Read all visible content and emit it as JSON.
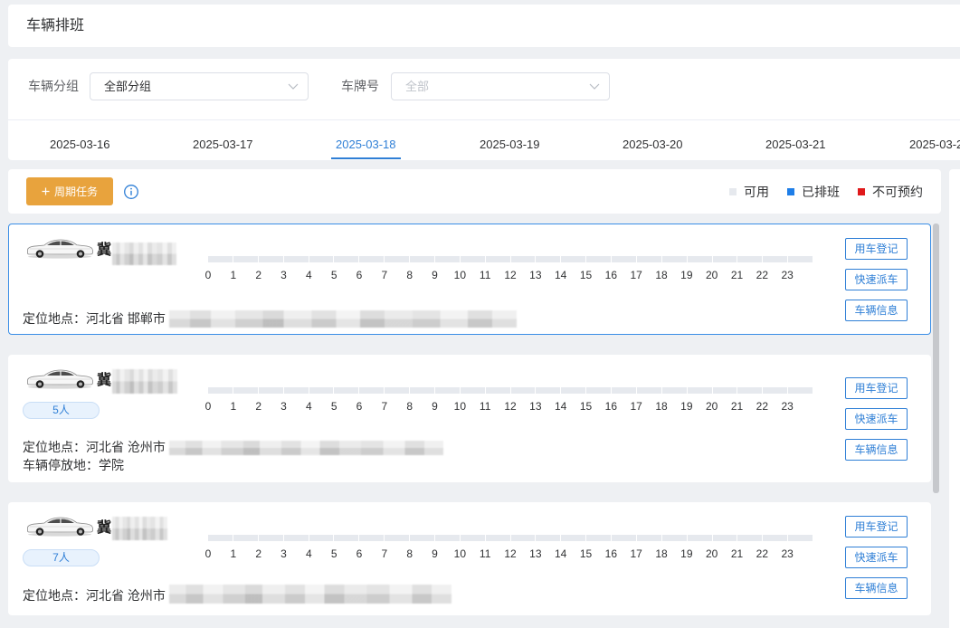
{
  "page": {
    "title": "车辆排班"
  },
  "filters": {
    "group": {
      "label": "车辆分组",
      "value": "全部分组"
    },
    "plate": {
      "label": "车牌号",
      "placeholder": "全部"
    }
  },
  "date_tabs": {
    "active_index": 2,
    "items": [
      "2025-03-16",
      "2025-03-17",
      "2025-03-18",
      "2025-03-19",
      "2025-03-20",
      "2025-03-21",
      "2025-03-2"
    ]
  },
  "toolbar": {
    "periodic_task_button": {
      "label": "周期任务",
      "icon": "plus-icon",
      "color": "#e8a33d"
    },
    "info_icon": "info-circle-icon"
  },
  "legend": [
    {
      "label": "可用",
      "color": "#e6e9ee"
    },
    {
      "label": "已排班",
      "color": "#1e7ee8"
    },
    {
      "label": "不可预约",
      "color": "#e0191b"
    }
  ],
  "timeline": {
    "hours": [
      "0",
      "1",
      "2",
      "3",
      "4",
      "5",
      "6",
      "7",
      "8",
      "9",
      "10",
      "11",
      "12",
      "13",
      "14",
      "15",
      "16",
      "17",
      "18",
      "19",
      "20",
      "21",
      "22",
      "23"
    ]
  },
  "vehicle_icon": "car-icon",
  "vehicle_actions": [
    "用车登记",
    "快速派车",
    "车辆信息"
  ],
  "vehicles": [
    {
      "plate_prefix": "冀",
      "selected": true,
      "location_label": "定位地点：",
      "location": "河北省 邯郸市"
    },
    {
      "plate_prefix": "冀",
      "selected": false,
      "capacity": "5人",
      "location_label": "定位地点：",
      "location": "河北省 沧州市",
      "parking_label": "车辆停放地：",
      "parking": "学院"
    },
    {
      "plate_prefix": "冀",
      "selected": false,
      "capacity": "7人",
      "location_label": "定位地点：",
      "location": "河北省 沧州市"
    }
  ],
  "colors": {
    "accent": "#2f7fd6",
    "selected_border": "#3a8ee6"
  }
}
